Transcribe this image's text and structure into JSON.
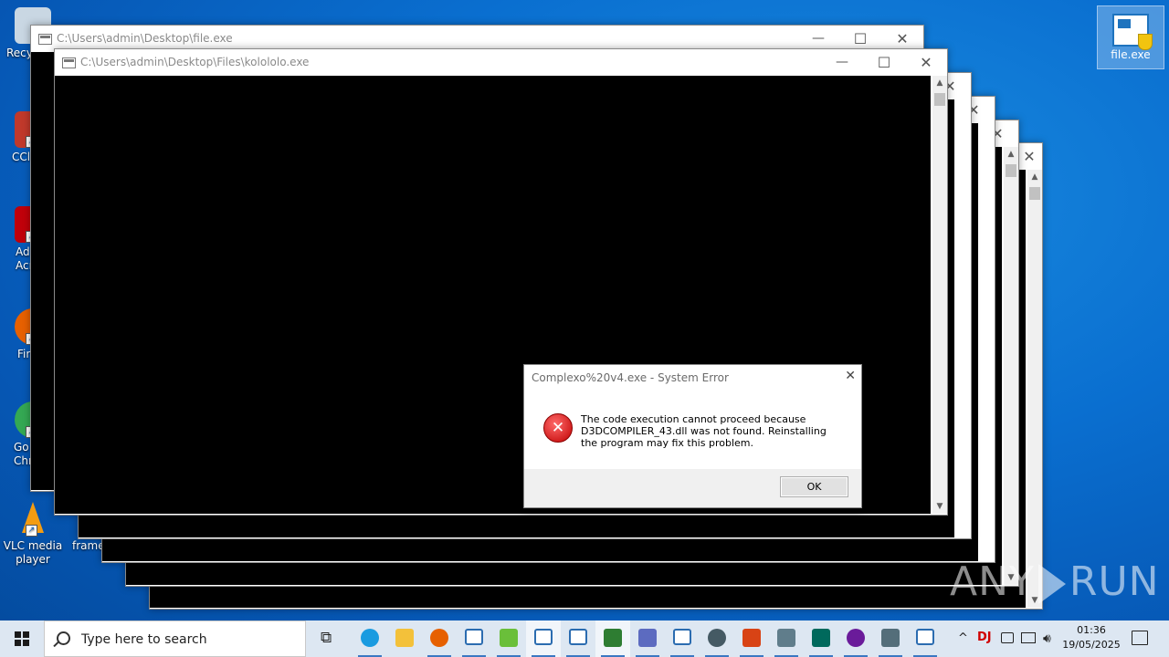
{
  "desktop": {
    "icons": [
      {
        "label": "Recy",
        "color": "#c9d7e3"
      },
      {
        "label": "CCl",
        "color": "#c0392b"
      },
      {
        "label": "Ad\nAcr",
        "color": "#c0000a"
      },
      {
        "label": "Fir",
        "color": "#e66000"
      },
      {
        "label": "Go\nChr",
        "color": "#34a853"
      },
      {
        "label": "VLC media player",
        "color": "#f39c12"
      },
      {
        "label": "frame",
        "color": "#ffffff"
      }
    ],
    "file_icon_label": "file.exe"
  },
  "windows": {
    "back": {
      "title": "C:\\Users\\admin\\Desktop\\file.exe"
    },
    "front": {
      "title": "C:\\Users\\admin\\Desktop\\Files\\kolololo.exe"
    },
    "minimize_glyph": "—",
    "maximize_glyph": "☐",
    "close_glyph": "✕",
    "scroll_up": "▲",
    "scroll_down": "▼"
  },
  "dialog": {
    "title": "Complexo%20v4.exe - System Error",
    "close_glyph": "✕",
    "error_glyph": "✕",
    "message": "The code execution cannot proceed because D3DCOMPILER_43.dll was not found. Reinstalling the program may fix this problem.",
    "ok_label": "OK"
  },
  "watermark": {
    "left": "ANY",
    "right": "RUN"
  },
  "taskbar": {
    "search_placeholder": "Type here to search",
    "task_view_glyph": "⧉",
    "apps": [
      {
        "name": "edge",
        "color": "#1a9be0"
      },
      {
        "name": "file-explorer",
        "color": "#f3c13a"
      },
      {
        "name": "firefox",
        "color": "#e66000"
      },
      {
        "name": "window-app",
        "color": "#2b6cb0"
      },
      {
        "name": "bh-app",
        "color": "#6abf3a"
      },
      {
        "name": "window-app-active",
        "color": "#2b6cb0"
      },
      {
        "name": "window-app-2",
        "color": "#2b6cb0"
      },
      {
        "name": "chess-app",
        "color": "#2e7d32"
      },
      {
        "name": "network-app",
        "color": "#5c6bc0"
      },
      {
        "name": "window-app-3",
        "color": "#2b6cb0"
      },
      {
        "name": "link-app",
        "color": "#455a64"
      },
      {
        "name": "office-app",
        "color": "#d84315"
      },
      {
        "name": "notepad-app",
        "color": "#607d8b"
      },
      {
        "name": "monitor-app",
        "color": "#00695c"
      },
      {
        "name": "purple-app",
        "color": "#6a1b9a"
      },
      {
        "name": "installer-app",
        "color": "#546e7a"
      },
      {
        "name": "window-app-4",
        "color": "#2b6cb0"
      }
    ],
    "tray": {
      "chevron": "^",
      "dj_label": "DJ",
      "clock_time": "01:36",
      "clock_date": "19/05/2025"
    }
  }
}
